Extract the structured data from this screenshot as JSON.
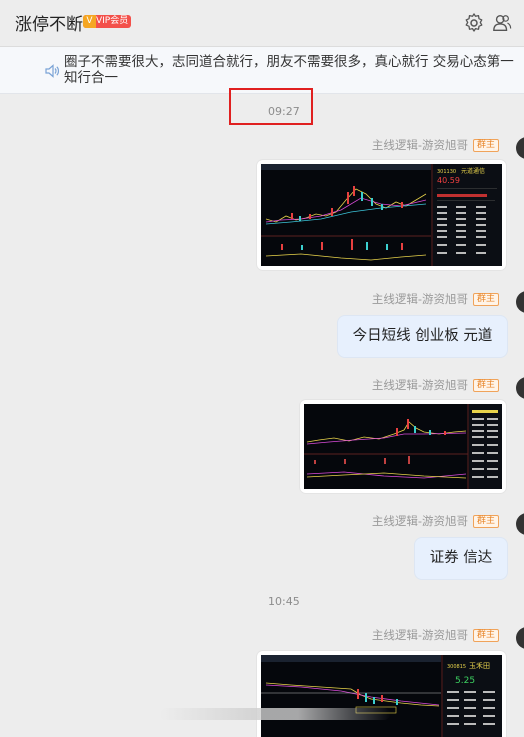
{
  "header": {
    "title": "涨停不断",
    "vip_badge": "VIP会员",
    "vip_icon_letter": "V",
    "icons": [
      "settings-icon",
      "members-icon"
    ]
  },
  "notice": {
    "icon": "speaker-icon",
    "text": "圈子不需要很大，志同道合就行，朋友不需要很多，真心就行 交易心态第一 知行合一"
  },
  "messages": [
    {
      "type": "time",
      "text": "09:27",
      "highlighted": true
    },
    {
      "type": "image",
      "sender": "主线逻辑-游资旭哥",
      "role": "群主",
      "image_label": "stock-chart-screenshot-1",
      "stock_code": "301130",
      "stock_name": "元道通信",
      "price": "40.59"
    },
    {
      "type": "text",
      "sender": "主线逻辑-游资旭哥",
      "role": "群主",
      "text": "今日短线  创业板 元道"
    },
    {
      "type": "image",
      "sender": "主线逻辑-游资旭哥",
      "role": "群主",
      "image_label": "stock-chart-screenshot-2"
    },
    {
      "type": "text",
      "sender": "主线逻辑-游资旭哥",
      "role": "群主",
      "text": "证券 信达"
    },
    {
      "type": "time",
      "text": "10:45",
      "highlighted": false
    },
    {
      "type": "image",
      "sender": "主线逻辑-游资旭哥",
      "role": "群主",
      "image_label": "stock-chart-screenshot-3",
      "stock_code": "300815",
      "stock_name": "玉禾田",
      "price": "5.25"
    }
  ],
  "colors": {
    "background": "#ededed",
    "bubble": "#e7f0fd",
    "owner_tag": "#e8862a",
    "highlight_box": "#e02020",
    "vip": "#f3504a"
  }
}
